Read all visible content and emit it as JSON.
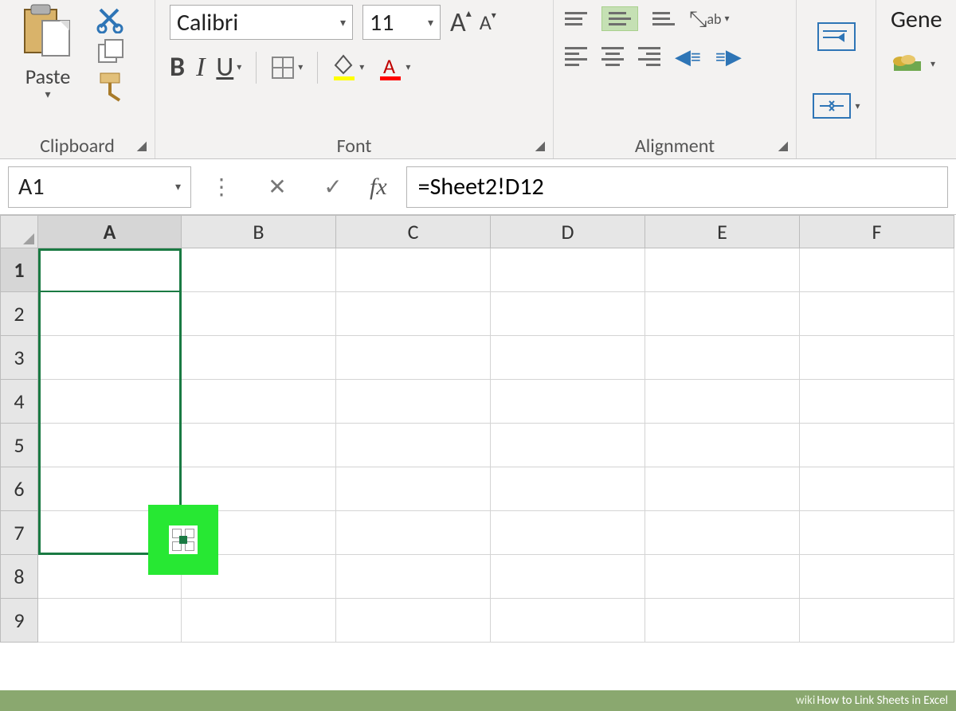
{
  "ribbon": {
    "clipboard": {
      "label": "Clipboard",
      "paste": "Paste"
    },
    "font": {
      "label": "Font",
      "name": "Calibri",
      "size": "11",
      "bold": "B",
      "italic": "I",
      "underline": "U"
    },
    "alignment": {
      "label": "Alignment"
    },
    "number": {
      "format": "Gene"
    }
  },
  "formula_bar": {
    "name_box": "A1",
    "fx": "fx",
    "value": "=Sheet2!D12"
  },
  "grid": {
    "columns": [
      "A",
      "B",
      "C",
      "D",
      "E",
      "F"
    ],
    "rows": [
      "1",
      "2",
      "3",
      "4",
      "5",
      "6",
      "7",
      "8",
      "9"
    ]
  },
  "footer": {
    "brand": "wiki",
    "title": "How to Link Sheets in Excel"
  }
}
